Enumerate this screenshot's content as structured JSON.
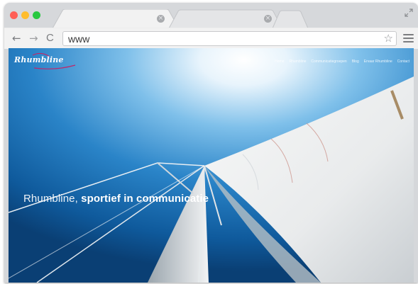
{
  "browser": {
    "tabs": [
      {
        "close_icon": "close-icon"
      },
      {
        "close_icon": "close-icon"
      }
    ],
    "address": "www",
    "icons": {
      "back": "←",
      "forward": "→",
      "reload": "C",
      "bookmark": "☆"
    },
    "traffic_light_colors": [
      "#ff5f57",
      "#ffbd2e",
      "#28c840"
    ]
  },
  "site": {
    "logo": "Rhumbline",
    "nav": [
      "Home",
      "Rhumbline",
      "Communicatiegroepen",
      "Blog",
      "Ervaar Rhumbline",
      "Contact"
    ],
    "hero_light": "Rhumbline,",
    "hero_bold": "sportief in communicatie"
  }
}
